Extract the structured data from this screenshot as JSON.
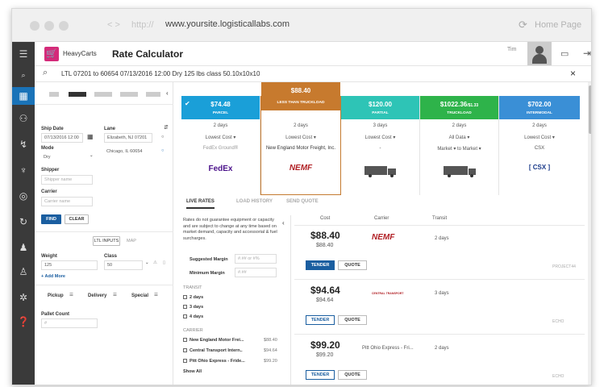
{
  "browser": {
    "nav": "< >",
    "protocol": "http://",
    "url": "www.yoursite.logisticallabs.com",
    "home": "Home Page"
  },
  "app": {
    "brand": "HeavyCarts",
    "title": "Rate Calculator",
    "user": "Tim"
  },
  "search": {
    "query": "LTL 07201 to 60654 07/13/2016 12:00 Dry 125 lbs class 50.10x10x10"
  },
  "form": {
    "ship_date_label": "Ship Date",
    "ship_date": "07/13/2016 12:00",
    "lane_label": "Lane",
    "lane_from": "Elizabeth, NJ 07201",
    "lane_to": "Chicago, IL 60654",
    "mode_label": "Mode",
    "mode": "Dry",
    "shipper_label": "Shipper",
    "shipper_ph": "Shipper name",
    "carrier_label": "Carrier",
    "carrier_ph": "Carrier name",
    "find": "FIND",
    "clear": "CLEAR",
    "ltl_inputs": "LTL INPUTS",
    "map": "MAP",
    "weight_label": "Weight",
    "weight": "125",
    "class_label": "Class",
    "class": "50",
    "add_more": "+ Add More",
    "pickup": "Pickup",
    "delivery": "Delivery",
    "special": "Special",
    "pallet_label": "Pallet Count",
    "pallet_ph": "#"
  },
  "cards": [
    {
      "price": "$74.48",
      "type": "Parcel",
      "days": "2 days",
      "cost": "Lowest Cost ▾",
      "carrier": "FedEx Ground®",
      "brand": "FedEx",
      "color": "#1a9fd8"
    },
    {
      "price": "$88.40",
      "type": "Less Than Truckload",
      "days": "2 days",
      "cost": "Lowest Cost ▾",
      "carrier": "New England Motor Freight, Inc.",
      "brand": "NEMF",
      "color": "#c77a2e"
    },
    {
      "price": "$120.00",
      "type": "Partial",
      "days": "3 days",
      "cost": "Lowest Cost ▾",
      "carrier": "-",
      "brand": "",
      "color": "#2ec4b6"
    },
    {
      "price": "$1022.36",
      "price_sub": "/$1.33",
      "type": "Truckload",
      "days": "2 days",
      "cost": "All Data ▾",
      "carrier": "Market ▾ to Market ▾",
      "brand": "",
      "color": "#2eb34a"
    },
    {
      "price": "$702.00",
      "type": "Intermodal",
      "days": "2 days",
      "cost": "Lowest Cost ▾",
      "carrier": "CSX",
      "brand": "CSX",
      "color": "#3a8fd6"
    }
  ],
  "tabs": [
    "LIVE RATES",
    "LOAD HISTORY",
    "SEND QUOTE"
  ],
  "filters": {
    "note": "Rates do not guarantee equipment or capacity and are subject to change at any time based on market demand, capacity and accessorial & fuel surcharges.",
    "sugg_label": "Suggested Margin",
    "sugg_ph": "#.## or #%",
    "min_label": "Minimum Margin",
    "min_ph": "#.##",
    "transit_label": "TRANSIT",
    "transit": [
      "2 days",
      "3 days",
      "4 days"
    ],
    "carrier_label": "CARRIER",
    "carriers": [
      {
        "name": "New England Motor Frei...",
        "price": "$88.40"
      },
      {
        "name": "Central Transport Intern..",
        "price": "$94.64"
      },
      {
        "name": "Pitt Ohio Express - Fride...",
        "price": "$99.20"
      }
    ],
    "show_all": "Show All"
  },
  "list": {
    "headers": [
      "Cost",
      "Carrier",
      "Transit"
    ],
    "rows": [
      {
        "price": "$88.40",
        "sub": "$88.40",
        "carrier": "NEMF",
        "transit": "2 days",
        "tag": "PROJECT44",
        "tender": "TENDER",
        "quote": "QUOTE"
      },
      {
        "price": "$94.64",
        "sub": "$94.64",
        "carrier": "CENTRAL TRANSPORT",
        "transit": "3 days",
        "tag": "ECHO",
        "tender": "TENDER",
        "quote": "QUOTE"
      },
      {
        "price": "$99.20",
        "sub": "$99.20",
        "carrier": "Pitt Ohio Express - Fri...",
        "transit": "2 days",
        "tag": "ECHO",
        "tender": "TENDER",
        "quote": "QUOTE"
      }
    ]
  }
}
